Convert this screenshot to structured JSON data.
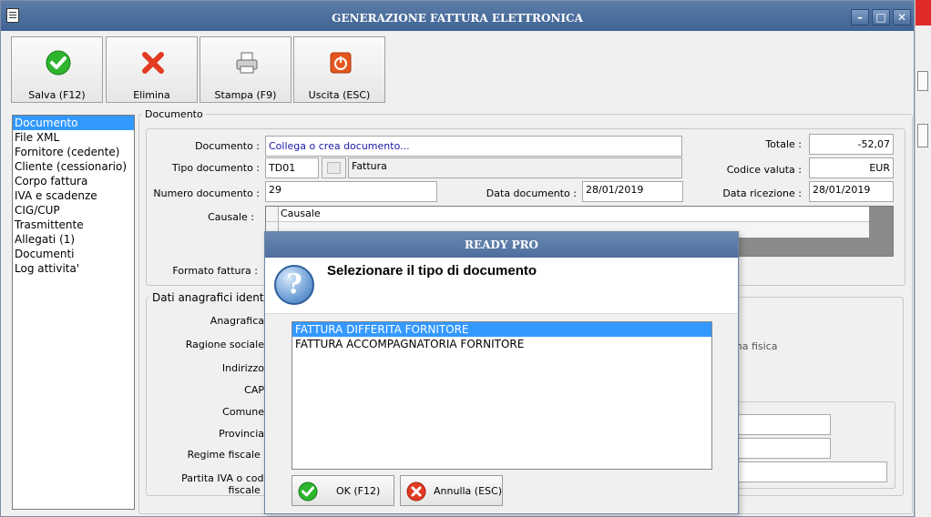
{
  "window": {
    "title": "GENERAZIONE FATTURA ELETTRONICA",
    "controls": [
      "–",
      "□",
      "✕"
    ]
  },
  "toolbar": {
    "save": "Salva (F12)",
    "delete": "Elimina",
    "print": "Stampa (F9)",
    "exit": "Uscita (ESC)"
  },
  "nav": {
    "items": [
      "Documento",
      "File XML",
      "Fornitore (cedente)",
      "Cliente (cessionario)",
      "Corpo fattura",
      "IVA e scadenze",
      "CIG/CUP",
      "Trasmittente",
      "Allegati (1)",
      "Documenti",
      "Log attivita'"
    ],
    "selected": "Documento"
  },
  "documento": {
    "legend": "Documento",
    "doc_label": "Documento :",
    "doc_value": "Collega o crea documento...",
    "tipo_label": "Tipo documento :",
    "tipo_code": "TD01",
    "tipo_desc": "Fattura",
    "numero_label": "Numero documento :",
    "numero_value": "29",
    "data_label": "Data documento :",
    "data_value": "28/01/2019",
    "totale_label": "Totale :",
    "totale_value": "-52,07",
    "valuta_label": "Codice valuta :",
    "valuta_value": "EUR",
    "ricezione_label": "Data ricezione :",
    "ricezione_value": "28/01/2019",
    "causale_label": "Causale :",
    "causale_col": "Causale",
    "formato_label": "Formato fattura :"
  },
  "anagrafici": {
    "legend": "Dati anagrafici identifi",
    "labels": [
      "Anagrafica",
      "Ragione sociale",
      "Indirizzo",
      "CAP",
      "Comune",
      "Provincia",
      "Regime fiscale :",
      "Partita IVA o cod. fiscale :"
    ],
    "persona_text": "ona fisica"
  },
  "dialog": {
    "title": "READY PRO",
    "message": "Selezionare il tipo di documento",
    "options": [
      "FATTURA DIFFERITA FORNITORE",
      "FATTURA ACCOMPAGNATORIA FORNITORE"
    ],
    "selected": "FATTURA DIFFERITA FORNITORE",
    "ok": "OK (F12)",
    "cancel": "Annulla (ESC)"
  }
}
